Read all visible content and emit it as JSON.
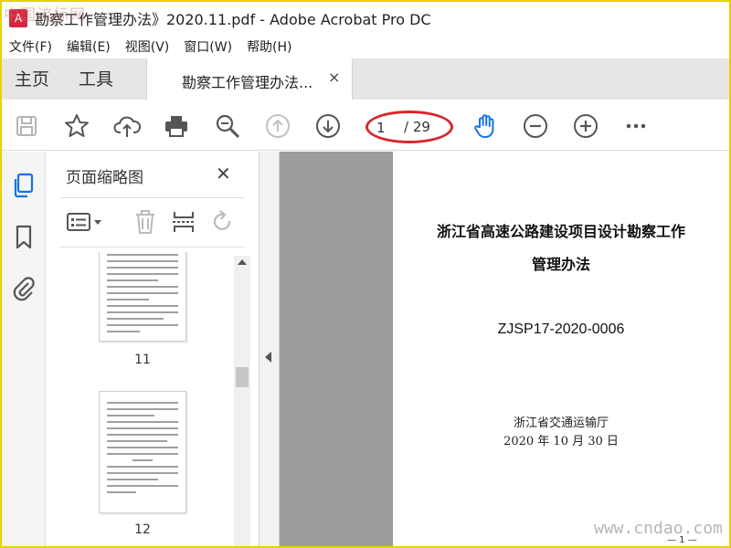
{
  "window": {
    "title": "勘察工作管理办法》2020.11.pdf - Adobe Acrobat Pro DC",
    "watermark_top": "中国流标网"
  },
  "menu": [
    "文件(F)",
    "编辑(E)",
    "视图(V)",
    "窗口(W)",
    "帮助(H)"
  ],
  "tabs": {
    "home": "主页",
    "tools": "工具",
    "document": "勘察工作管理办法...",
    "close_glyph": "×"
  },
  "toolbar": {
    "current_page": "1",
    "total_pages": "/ 29",
    "icons": [
      "save-icon",
      "star-icon",
      "upload-cloud-icon",
      "print-icon",
      "zoom-search-icon",
      "page-up-icon",
      "page-down-icon",
      "hand-tool-icon",
      "zoom-out-icon",
      "zoom-in-icon",
      "more-icon"
    ],
    "accent_color": "#1473e6",
    "highlight_color": "#d9262b"
  },
  "side_panel": {
    "title": "页面缩略图",
    "close_glyph": "✕",
    "thumbnails": [
      {
        "page_label": "11"
      },
      {
        "page_label": "12"
      }
    ]
  },
  "document": {
    "title_line1": "浙江省高速公路建设项目设计勘察工作",
    "title_line2": "管理办法",
    "code": "ZJSP17-2020-0006",
    "issuer": "浙江省交通运输厅",
    "date": "2020 年 10 月 30 日",
    "page_number": "— 1 —"
  },
  "watermark_bottom": "www.cndao.com"
}
